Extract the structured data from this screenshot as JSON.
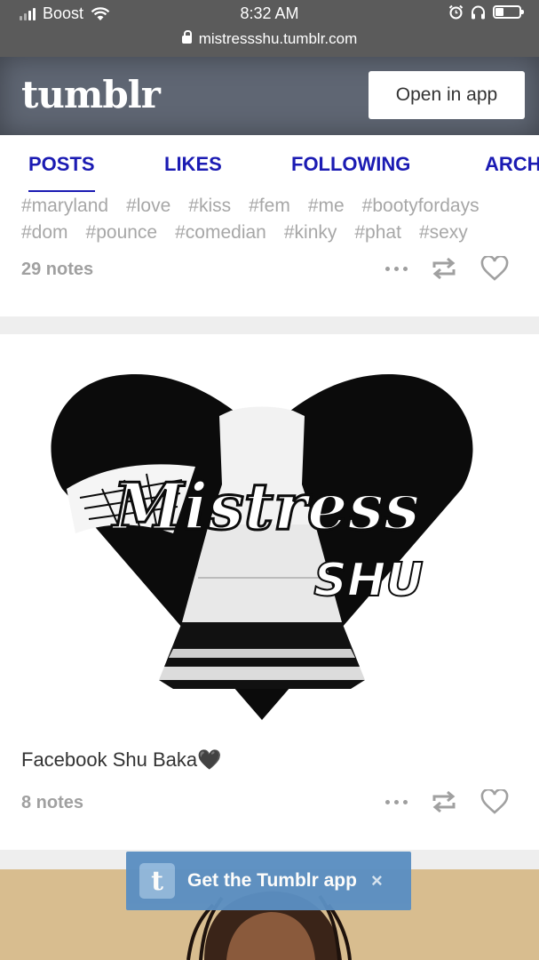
{
  "status_bar": {
    "carrier": "Boost",
    "time": "8:32 AM",
    "url": "mistressshu.tumblr.com"
  },
  "header": {
    "logo": "tumblr",
    "open_app_label": "Open in app"
  },
  "tabs": [
    {
      "label": "POSTS"
    },
    {
      "label": "LIKES"
    },
    {
      "label": "FOLLOWING"
    },
    {
      "label": "ARCHIVE"
    }
  ],
  "post1": {
    "tags_row1": [
      "#maryland",
      "#love",
      "#kiss",
      "#fem",
      "#me",
      "#bootyfordays"
    ],
    "tags_row2": [
      "#dom",
      "#pounce",
      "#comedian",
      "#kinky",
      "#phat",
      "#sexy"
    ],
    "notes": "29 notes"
  },
  "post2": {
    "image_text_main": "Mistress",
    "image_text_sub": "SHU",
    "caption": "Facebook Shu Baka🖤",
    "notes": "8 notes"
  },
  "banner": {
    "label": "Get the Tumblr app",
    "logo_letter": "t",
    "close": "×"
  },
  "colors": {
    "header_bg": "#5f6673",
    "tab_text": "#1b1bb3",
    "banner_bg": "#5b8fc2",
    "tag_text": "#a7a7a7"
  },
  "icons": [
    "wifi-icon",
    "lock-icon",
    "alarm-icon",
    "headphones-icon",
    "battery-icon",
    "more-dots-icon",
    "reblog-icon",
    "heart-icon",
    "close-icon"
  ]
}
